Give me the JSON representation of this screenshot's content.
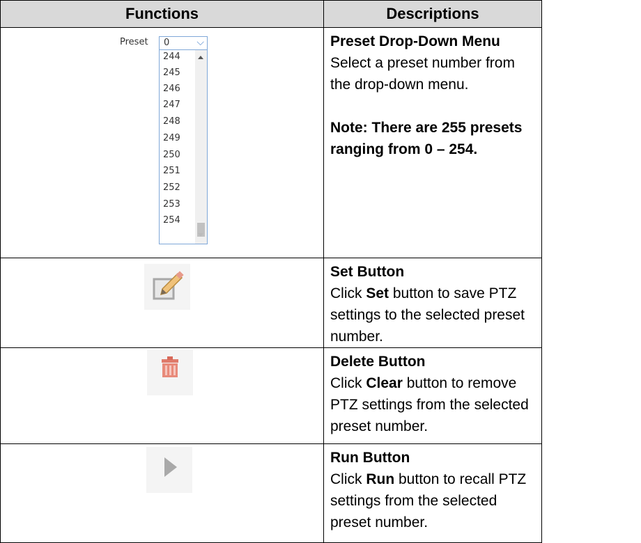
{
  "headers": {
    "functions": "Functions",
    "descriptions": "Descriptions"
  },
  "preset_widget": {
    "label": "Preset",
    "selected": "0",
    "options": [
      "244",
      "245",
      "246",
      "247",
      "248",
      "249",
      "250",
      "251",
      "252",
      "253",
      "254"
    ]
  },
  "rows": [
    {
      "title": "Preset Drop-Down Menu",
      "text": "Select a preset number from the drop-down menu.",
      "note": "Note: There are 255 presets ranging from 0 – 254."
    },
    {
      "title": "Set Button",
      "pre": "Click ",
      "bold": "Set",
      "post": " button to save PTZ settings to the selected preset number.",
      "icon": "edit-pencil-icon"
    },
    {
      "title": "Delete Button",
      "pre": "Click ",
      "bold": "Clear",
      "post": " button to remove PTZ settings from the selected preset number.",
      "icon": "trash-icon"
    },
    {
      "title": "Run Button",
      "pre": "Click ",
      "bold": "Run",
      "post": " button to recall PTZ settings from the selected preset number.",
      "icon": "play-icon"
    }
  ]
}
